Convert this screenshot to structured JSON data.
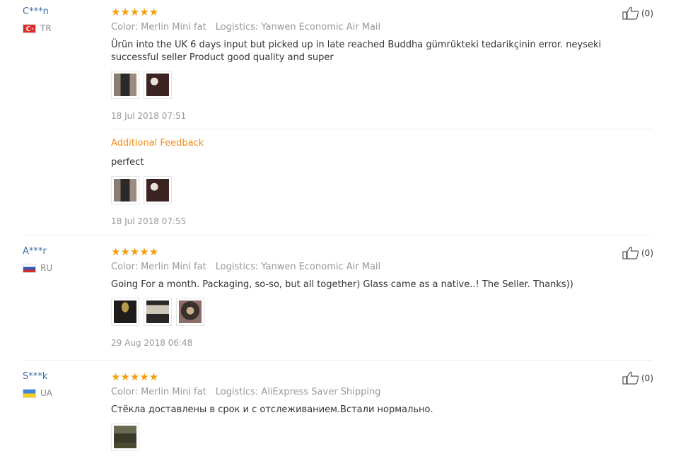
{
  "reviews": [
    {
      "user": "C***n",
      "country": "TR",
      "stars": "★★★★★",
      "color_label": "Color:",
      "color_value": "Merlin Mini fat",
      "logistics_label": "Logistics:",
      "logistics_value": "Yanwen Economic Air Mail",
      "text": "Ürün into the UK 6 days input but picked up in late reached Buddha gümrükteki tedarikçinin error. neyseki successful seller Product good quality and super",
      "date": "18 Jul 2018 07:51",
      "likes": "(0)",
      "additional_label": "Additional Feedback",
      "additional_text": "perfect",
      "additional_date": "18 Jul 2018 07:55"
    },
    {
      "user": "A***r",
      "country": "RU",
      "stars": "★★★★★",
      "color_label": "Color:",
      "color_value": "Merlin Mini fat",
      "logistics_label": "Logistics:",
      "logistics_value": "Yanwen Economic Air Mail",
      "text": "Going For a month. Packaging, so-so, but all together) Glass came as a native..! The Seller. Thanks))",
      "date": "29 Aug 2018 06:48",
      "likes": "(0)"
    },
    {
      "user": "S***k",
      "country": "UA",
      "stars": "★★★★★",
      "color_label": "Color:",
      "color_value": "Merlin Mini fat",
      "logistics_label": "Logistics:",
      "logistics_value": "AliExpress Saver Shipping",
      "text": "Стёкла доставлены в срок и с отслеживанием.Встали нормально.",
      "likes": "(0)"
    }
  ],
  "icons": {
    "like": "thumbs-up-icon",
    "star": "star-icon"
  },
  "colors": {
    "star": "#f59f10",
    "username": "#3d6ea8",
    "additional": "#f08c1a"
  }
}
